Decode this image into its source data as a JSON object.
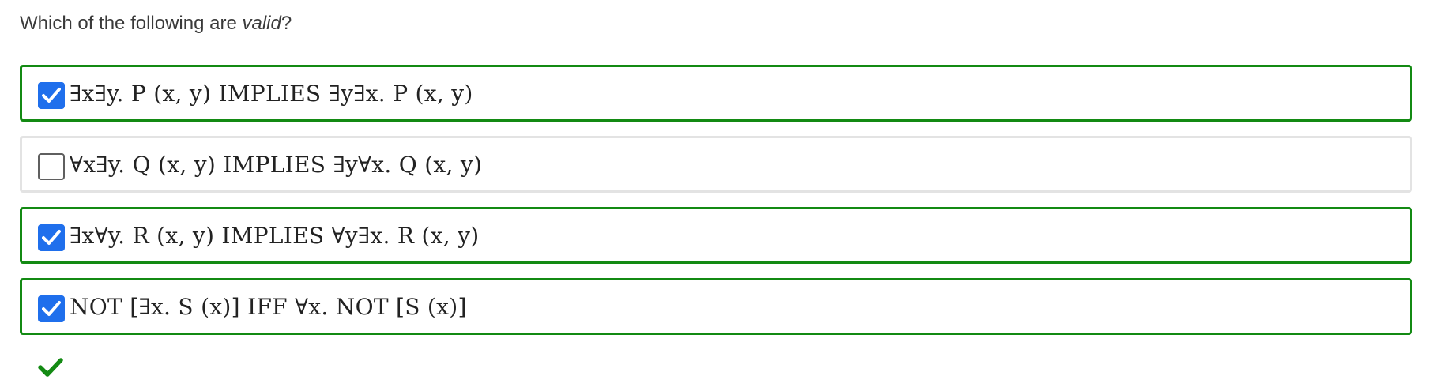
{
  "question": {
    "prefix": "Which of the following are ",
    "emphasis": "valid",
    "suffix": "?"
  },
  "options": [
    {
      "formula": "∃x∃y. P (x, y)  IMPLIES ∃y∃x. P (x, y)",
      "checked": true
    },
    {
      "formula": "∀x∃y. Q (x, y)  IMPLIES ∃y∀x. Q (x, y)",
      "checked": false
    },
    {
      "formula": "∃x∀y. R (x, y)  IMPLIES ∀y∃x. R (x, y)",
      "checked": true
    },
    {
      "formula": "NOT [∃x. S (x)]  IFF ∀x. NOT [S (x)]",
      "checked": true
    }
  ],
  "colors": {
    "selected_border": "#138a13",
    "unselected_border": "#e3e3e3",
    "checkbox_checked": "#1f6fec",
    "feedback_correct": "#138a13"
  },
  "icons": {
    "checkbox_check": "check-icon",
    "feedback": "correct-check-icon"
  }
}
